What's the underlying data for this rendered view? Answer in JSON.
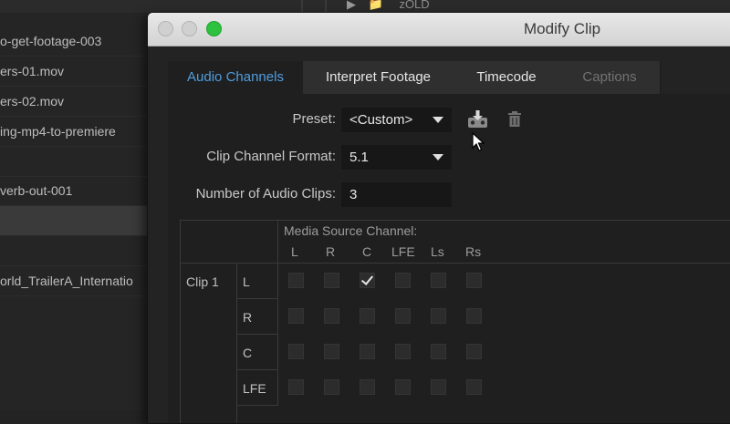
{
  "background": {
    "files": [
      "o-get-footage-003",
      "ers-01.mov",
      "ers-02.mov",
      "ing-mp4-to-premiere",
      "",
      "verb-out-001",
      "",
      "",
      "orld_TrailerA_Internatio"
    ],
    "folder_label": "zOLD"
  },
  "dialog": {
    "title": "Modify Clip",
    "tabs": [
      {
        "label": "Audio Channels"
      },
      {
        "label": "Interpret Footage"
      },
      {
        "label": "Timecode"
      },
      {
        "label": "Captions"
      }
    ],
    "preset_label": "Preset:",
    "preset_value": "<Custom>",
    "format_label": "Clip Channel Format:",
    "format_value": "5.1",
    "num_clips_label": "Number of Audio Clips:",
    "num_clips_value": "3",
    "icons": {
      "save": "save-preset-icon",
      "delete": "trash-icon"
    },
    "grid": {
      "header": "Media Source Channel:",
      "columns": [
        "L",
        "R",
        "C",
        "LFE",
        "Ls",
        "Rs"
      ],
      "clip_label": "Clip 1",
      "rows": [
        {
          "label": "L",
          "checks": [
            false,
            false,
            true,
            false,
            false,
            false
          ]
        },
        {
          "label": "R",
          "checks": [
            false,
            false,
            false,
            false,
            false,
            false
          ]
        },
        {
          "label": "C",
          "checks": [
            false,
            false,
            false,
            false,
            false,
            false
          ]
        },
        {
          "label": "LFE",
          "checks": [
            false,
            false,
            false,
            false,
            false,
            false
          ]
        }
      ]
    },
    "colors": {
      "active_tab": "#4f9ee0",
      "zoom_button": "#2cc23f"
    }
  }
}
